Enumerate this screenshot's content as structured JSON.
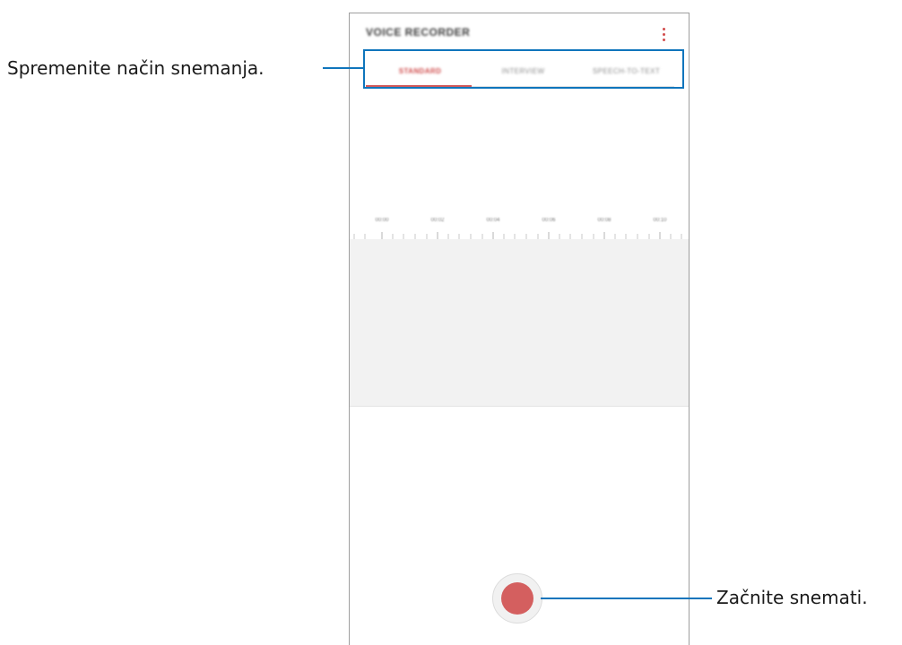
{
  "app": {
    "title": "VOICE RECORDER",
    "more_icon": "more-vertical-icon"
  },
  "tabs": [
    {
      "label": "STANDARD",
      "active": true
    },
    {
      "label": "INTERVIEW",
      "active": false
    },
    {
      "label": "SPEECH-TO-TEXT",
      "active": false
    }
  ],
  "timeline": {
    "labels": [
      "00:00",
      "00:02",
      "00:04",
      "00:06",
      "00:08",
      "00:10"
    ]
  },
  "record_button": {
    "icon": "record-icon",
    "color": "#d45f5f"
  },
  "annotations": {
    "mode": "Spremenite način snemanja.",
    "record": "Začnite snemati."
  },
  "colors": {
    "accent": "#d35a5a",
    "callout": "#0f75bc"
  }
}
